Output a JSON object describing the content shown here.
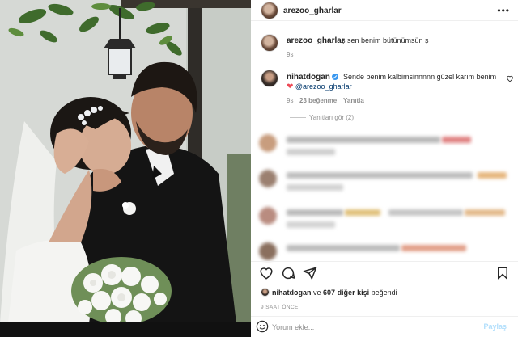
{
  "post": {
    "author": "arezoo_gharlar",
    "more_icon": "more-horizontal-icon"
  },
  "caption": {
    "author": "arezoo_gharlar",
    "text": "ş sen benim bütünümsün ş",
    "time": "9s"
  },
  "comment": {
    "author": "nihatdogan",
    "verified": true,
    "text": "Sende benim kalbimsinnnnn güzel karım benim",
    "heart": "❤",
    "mention": "@arezoo_gharlar",
    "time": "9s",
    "likes": "23 beğenme",
    "reply": "Yanıtla",
    "view_replies": "Yanıtları gör (2)"
  },
  "actions": {
    "icons": [
      "heart-icon",
      "comment-icon",
      "share-icon",
      "bookmark-icon"
    ]
  },
  "likes": {
    "user": "nihatdogan",
    "connector": "ve",
    "others": "607 diğer kişi",
    "suffix": "beğendi"
  },
  "timestamp": "9 SAAT ÖNCE",
  "comment_box": {
    "placeholder": "Yorum ekle...",
    "post_label": "Paylaş"
  },
  "colors": {
    "verified": "#3897f0",
    "heart": "#ed4956",
    "post_button": "#b2dffc",
    "mention": "#00376b"
  }
}
